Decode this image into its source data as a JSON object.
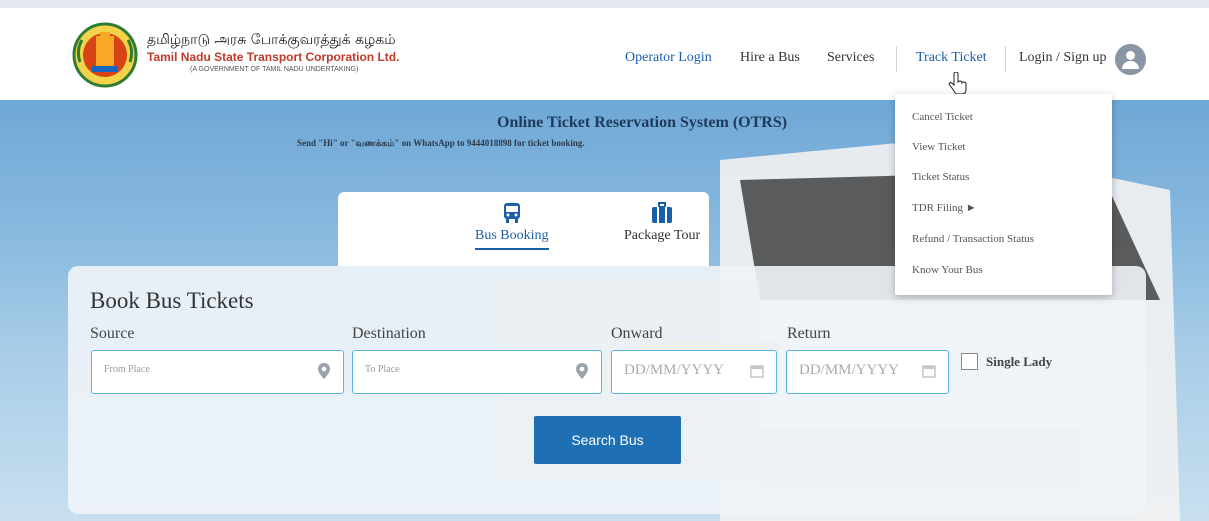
{
  "brand": {
    "tamil": "தமிழ்நாடு அரசு போக்குவரத்துக் கழகம்",
    "english": "Tamil Nadu State Transport Corporation Ltd.",
    "sub": "(A GOVERNMENT OF TAMIL NADU UNDERTAKING)"
  },
  "nav": {
    "operator_login": "Operator Login",
    "hire_bus": "Hire a Bus",
    "services": "Services",
    "track_ticket": "Track Ticket",
    "login_signup": "Login / Sign up"
  },
  "hero": {
    "title": "Online Ticket Reservation System (OTRS)",
    "subtitle": "Send \"Hi\" or \"வணக்கம்\" on WhatsApp to 9444018898 for ticket booking."
  },
  "tabs": [
    {
      "label": "Bus Booking",
      "icon": "bus-icon",
      "active": true
    },
    {
      "label": "Package Tour",
      "icon": "luggage-icon",
      "active": false
    }
  ],
  "booking": {
    "title": "Book Bus Tickets",
    "source_label": "Source",
    "source_placeholder": "From Place",
    "destination_label": "Destination",
    "destination_placeholder": "To Place",
    "onward_label": "Onward",
    "onward_placeholder": "DD/MM/YYYY",
    "return_label": "Return",
    "return_placeholder": "DD/MM/YYYY",
    "single_lady": "Single Lady",
    "search_button": "Search Bus"
  },
  "track_menu": [
    "Cancel Ticket",
    "View Ticket",
    "Ticket Status",
    "TDR Filing  ►",
    "Refund / Transaction Status",
    "Know Your Bus"
  ],
  "colors": {
    "primary": "#1e6fb3",
    "link": "#1a5fa8",
    "accent_red": "#c0392b",
    "field_border": "#58b5e6"
  }
}
